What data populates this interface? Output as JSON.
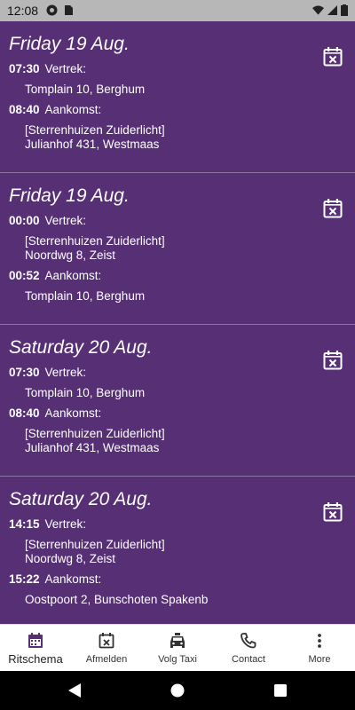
{
  "status_bar": {
    "time": "12:08"
  },
  "trips": [
    {
      "date": "Friday 19 Aug.",
      "departure": {
        "time": "07:30",
        "label": "Vertrek:",
        "lines": [
          "Tomplain 10, Berghum"
        ]
      },
      "arrival": {
        "time": "08:40",
        "label": "Aankomst:",
        "lines": [
          "[Sterrenhuizen Zuiderlicht]",
          "Julianhof 431, Westmaas"
        ]
      }
    },
    {
      "date": "Friday 19 Aug.",
      "departure": {
        "time": "00:00",
        "label": "Vertrek:",
        "lines": [
          "[Sterrenhuizen Zuiderlicht]",
          "Noordwg 8, Zeist"
        ]
      },
      "arrival": {
        "time": "00:52",
        "label": "Aankomst:",
        "lines": [
          "Tomplain 10, Berghum"
        ]
      }
    },
    {
      "date": "Saturday 20 Aug.",
      "departure": {
        "time": "07:30",
        "label": "Vertrek:",
        "lines": [
          "Tomplain 10, Berghum"
        ]
      },
      "arrival": {
        "time": "08:40",
        "label": "Aankomst:",
        "lines": [
          "[Sterrenhuizen Zuiderlicht]",
          "Julianhof 431, Westmaas"
        ]
      }
    },
    {
      "date": "Saturday 20 Aug.",
      "departure": {
        "time": "14:15",
        "label": "Vertrek:",
        "lines": [
          "[Sterrenhuizen Zuiderlicht]",
          "Noordwg 8, Zeist"
        ]
      },
      "arrival": {
        "time": "15:22",
        "label": "Aankomst:",
        "lines": [
          "Oostpoort 2, Bunschoten Spakenb"
        ]
      }
    }
  ],
  "bottom_nav": {
    "items": [
      {
        "label": "Ritschema",
        "icon": "calendar-icon",
        "active": true
      },
      {
        "label": "Afmelden",
        "icon": "calendar-cancel-icon"
      },
      {
        "label": "Volg Taxi",
        "icon": "taxi-icon"
      },
      {
        "label": "Contact",
        "icon": "phone-icon"
      },
      {
        "label": "More",
        "icon": "more-vertical-icon"
      }
    ]
  },
  "colors": {
    "background": "#562f75",
    "accent": "#562f75",
    "status_bar": "#b7b7b7"
  }
}
